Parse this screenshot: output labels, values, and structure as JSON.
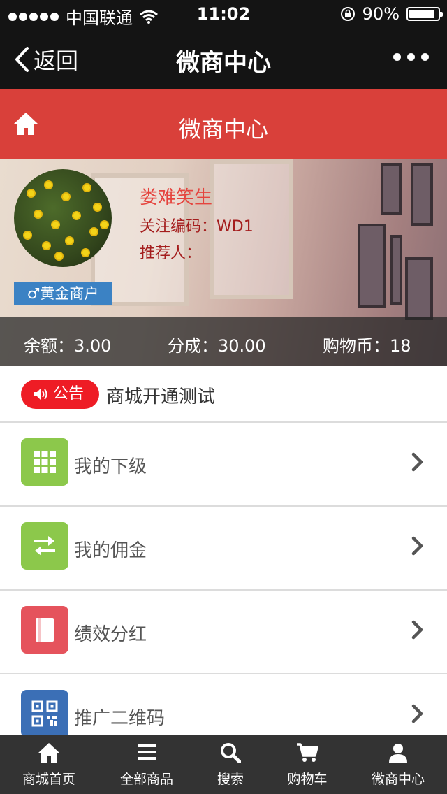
{
  "status_bar": {
    "carrier": "中国联通",
    "time": "11:02",
    "battery": "90%",
    "battery_level": 0.9
  },
  "nav": {
    "back_label": "返回",
    "title": "微商中心"
  },
  "header": {
    "title": "微商中心"
  },
  "profile": {
    "name": "娄难笑生",
    "follow_code": "关注编码：WD1",
    "referrer": "推荐人：",
    "level": "♂黄金商户",
    "stats": {
      "balance": "余额：3.00",
      "share": "分成：30.00",
      "coins": "购物币：18"
    }
  },
  "notice": {
    "badge": "公告",
    "text": "商城开通测试"
  },
  "menu": [
    {
      "label": "我的下级",
      "icon": "grid-icon",
      "color": "#8cc84b"
    },
    {
      "label": "我的佣金",
      "icon": "transfer-icon",
      "color": "#8cc84b"
    },
    {
      "label": "绩效分红",
      "icon": "book-icon",
      "color": "#e5535c"
    },
    {
      "label": "推广二维码",
      "icon": "qrcode-icon",
      "color": "#3b6fb6"
    }
  ],
  "tabs": [
    {
      "label": "商城首页",
      "icon": "home-icon"
    },
    {
      "label": "全部商品",
      "icon": "list-icon"
    },
    {
      "label": "搜索",
      "icon": "search-icon"
    },
    {
      "label": "购物车",
      "icon": "cart-icon"
    },
    {
      "label": "微商中心",
      "icon": "user-icon"
    }
  ]
}
